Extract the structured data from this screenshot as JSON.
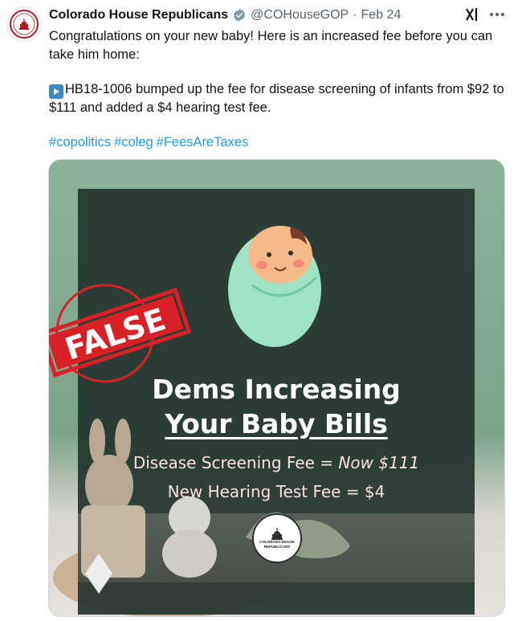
{
  "tweet": {
    "author_name": "Colorado House Republicans",
    "handle": "@COHouseGOP",
    "separator": "·",
    "date": "Feb 24",
    "text_line1": "Congratulations on your new baby! Here is an increased fee before you can take him home:",
    "text_line2": "HB18-1006 bumped up the fee for disease screening of infants from $92 to $111 and added a $4 hearing test fee.",
    "hashtags": [
      "#copolitics",
      "#coleg",
      "#FeesAreTaxes"
    ]
  },
  "media": {
    "headline_line1": "Dems Increasing",
    "headline_line2": "Your Baby Bills",
    "fee_line1_prefix": "Disease Screening Fee = ",
    "fee_line1_value": "Now $111",
    "fee_line2": "New Hearing Test Fee = $4",
    "stamp_text": "FALSE",
    "logo_text": "COLORADO HOUSE REPUBLICANS"
  },
  "icons": {
    "verified": "verified-badge-icon",
    "grok": "grok-icon",
    "more": "more-options-icon",
    "play": "play-button-emoji"
  },
  "colors": {
    "link": "#1d9bf0",
    "stamp_red": "#d92027",
    "verified_gray": "#829aab"
  }
}
